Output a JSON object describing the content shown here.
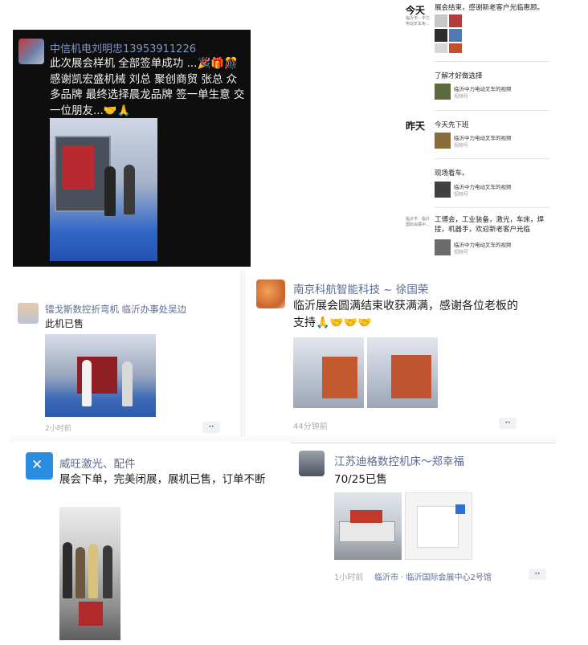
{
  "post_dark": {
    "author": "中信机电刘明忠13953911226",
    "text": "此次展会样机 全部签单成功 ...🎉🎁🎊 感谢凯宏盛机械 刘总 聚创商贸 张总 众多品牌 最终选择晨龙品牌 签一单生意 交一位朋友...🤝🙏"
  },
  "chat": {
    "day_today": "今天",
    "day_today_sub": "临沂市 · 中力电动叉车免...",
    "msg1": "展会结束，感谢新老客户光临惠顾。",
    "msg2": "了解才好做选择",
    "card_title": "临沂中力电动叉车的视频",
    "card_sub": "视频号",
    "day_yesterday": "昨天",
    "msg3": "今天先下班",
    "msg4": "现场看车。",
    "sub3": "临沂市 · 临沂国际会展中...",
    "msg5": "工博会，工业装备，激光，车床，焊接，机器手，欢迎新老客户光临"
  },
  "post_b": {
    "author": "镭戈斯数控折弯机 临沂办事处吴边",
    "text": "此机已售",
    "time": "2小时前",
    "more_label": "··"
  },
  "post_c": {
    "author": "南京科航智能科技 ~ 徐国荣",
    "text": "临沂展会圆满结束收获满满，感谢各位老板的支持🙏🤝🤝🤝",
    "time": "44分钟前",
    "more_label": "··"
  },
  "post_d": {
    "author": "威旺激光、配件",
    "text": "展会下单，完美闭展，展机已售，订单不断"
  },
  "post_e": {
    "author": "江苏迪格数控机床～郑幸福",
    "text": "70/25已售",
    "time": "1小时前",
    "location": "临沂市 · 临沂国际会展中心2号馆",
    "more_label": "··"
  },
  "colors": {
    "name_blue": "#5b6b91",
    "dark_bg": "#0e0e0e",
    "dark_name": "#7f96c5"
  }
}
